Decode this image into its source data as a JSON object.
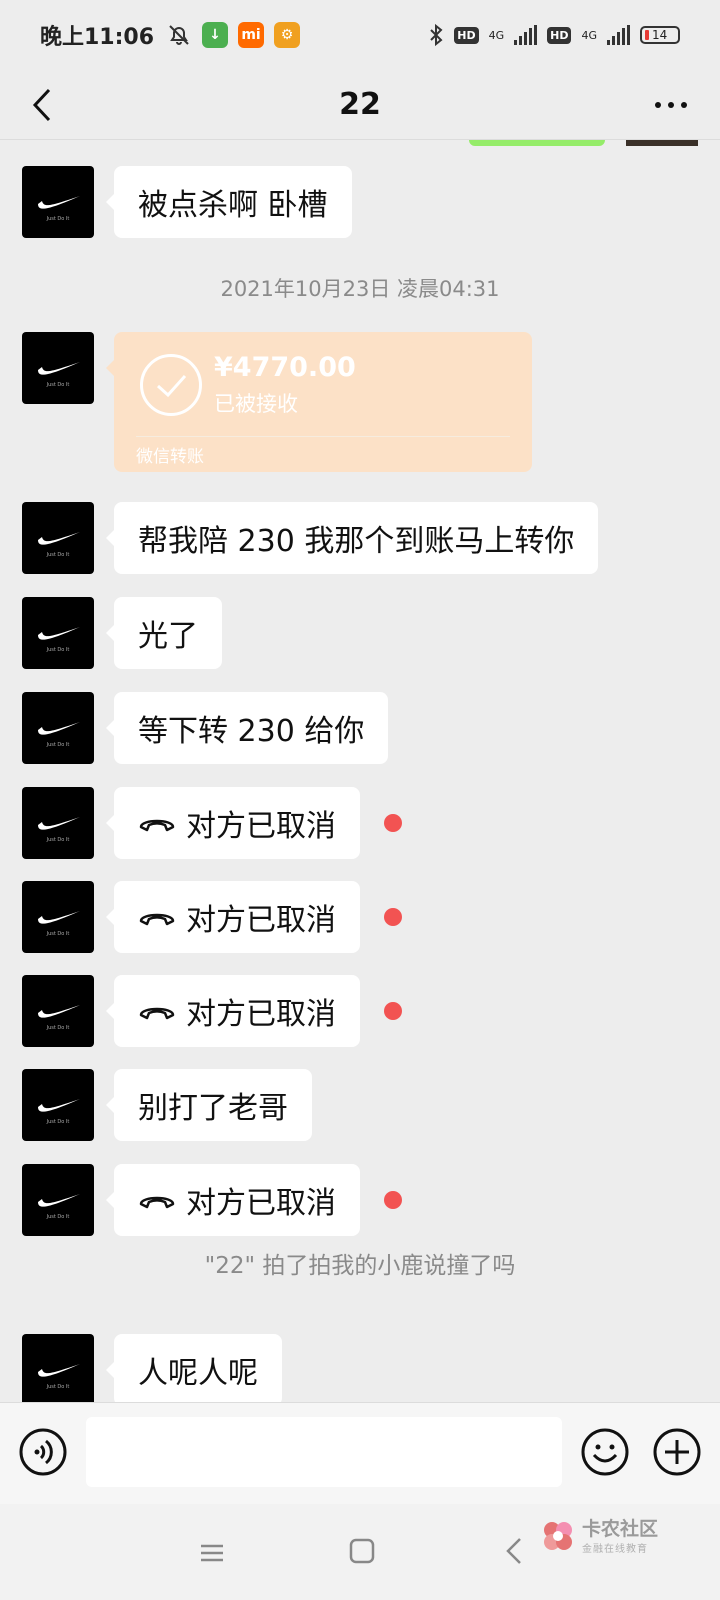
{
  "status_bar": {
    "time": "晚上11:06",
    "hd1": "HD",
    "net1": "4G",
    "hd2": "HD",
    "net2": "4G",
    "battery": "14"
  },
  "header": {
    "title": "22"
  },
  "messages": {
    "m1": "被点杀啊 卧槽",
    "timestamp": "2021年10月23日 凌晨04:31",
    "transfer": {
      "amount": "¥4770.00",
      "status": "已被接收",
      "label": "微信转账"
    },
    "m2": "帮我陪 230 我那个到账马上转你",
    "m3": "光了",
    "m4": "等下转 230 给你",
    "call1": "对方已取消",
    "call2": "对方已取消",
    "call3": "对方已取消",
    "m5": "别打了老哥",
    "call4": "对方已取消",
    "system": "\"22\" 拍了拍我的小鹿说撞了吗",
    "m6": "人呢人呢"
  },
  "avatar": {
    "tagline": "Just Do It"
  },
  "input": {
    "value": "",
    "placeholder": ""
  },
  "watermark": {
    "title": "卡农社区",
    "subtitle": "金融在线教育"
  },
  "colors": {
    "chat_bg": "#ededed",
    "bubble": "#ffffff",
    "transfer": "#fce1c7",
    "unread": "#f25352",
    "sent_bubble": "#95ec69"
  }
}
